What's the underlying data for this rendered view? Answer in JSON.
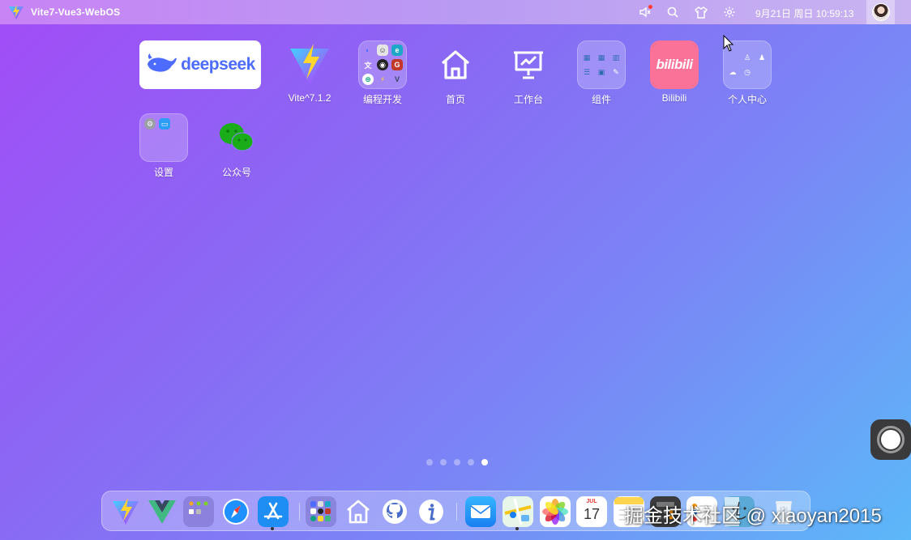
{
  "topbar": {
    "title": "Vite7-Vue3-WebOS",
    "datetime": "9月21日 周日 10:59:13",
    "icons": [
      "speaker-icon",
      "search-icon",
      "tshirt-icon",
      "gear-icon"
    ]
  },
  "desktop": {
    "deepseek": {
      "text": "deepseek"
    },
    "apps": [
      {
        "label": "Vite^7.1.2",
        "icon": "vite-icon"
      },
      {
        "label": "编程开发",
        "icon": "folder"
      },
      {
        "label": "首页",
        "icon": "home-icon"
      },
      {
        "label": "工作台",
        "icon": "dashboard-icon"
      },
      {
        "label": "组件",
        "icon": "folder"
      },
      {
        "label": "Bilibili",
        "icon": "bilibili-icon",
        "text": "bilibili",
        "color": "#fb7299"
      },
      {
        "label": "个人中心",
        "icon": "folder"
      },
      {
        "label": "设置",
        "icon": "folder"
      },
      {
        "label": "公众号",
        "icon": "wechat-icon",
        "color": "#1aad19"
      }
    ]
  },
  "pagination": {
    "count": 5,
    "active": 5
  },
  "dock": {
    "items": [
      "vite-icon",
      "vue-icon",
      "apps-folder-icon",
      "safari-icon",
      "app-store-icon",
      "dev-folder-icon",
      "home-icon",
      "github-icon",
      "info-icon",
      "mail-icon",
      "maps-icon",
      "photos-icon",
      "calendar-icon",
      "notes-icon",
      "calculator-icon",
      "reminders-icon",
      "finder-icon",
      "trash-icon"
    ],
    "calendar_month": "JUL",
    "calendar_day": "17"
  },
  "watermark": "掘金技术社区 @ xiaoyan2015",
  "colors": {
    "accent": "#4d6bfe",
    "bilibili": "#fb7299",
    "wechat": "#1aad19"
  }
}
